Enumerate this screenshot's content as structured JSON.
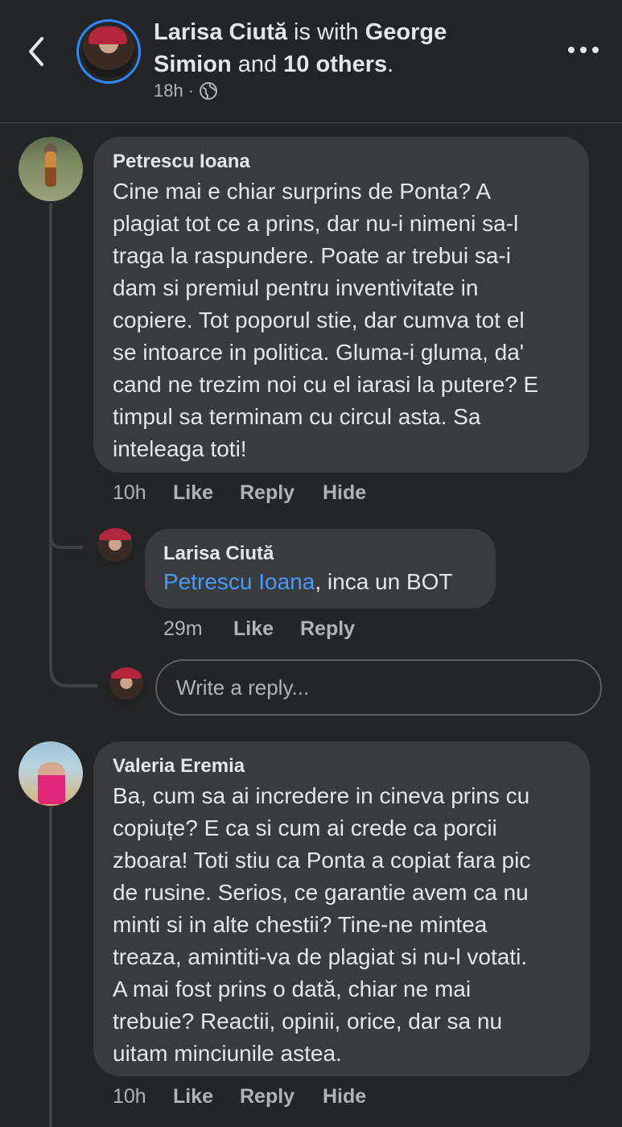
{
  "header": {
    "author": "Larisa Ciută",
    "with_text": " is with ",
    "tagged": "George Simion",
    "and_text": " and ",
    "others": "10 others",
    "period": ".",
    "time": "18h",
    "dot": "·",
    "privacy_icon": "globe-icon",
    "back_icon": "chevron-left-icon",
    "more_icon": "more-horizontal-icon"
  },
  "comments": [
    {
      "author": "Petrescu Ioana",
      "lines": [
        "Cine mai e chiar surprins de Ponta? A",
        "plagiat tot ce a prins, dar nu-i nimeni sa-l",
        "traga la raspundere. Poate ar trebui sa-i",
        "dam si premiul pentru inventivitate in",
        "copiere. Tot poporul stie, dar cumva tot el",
        "se intoarce in politica. Gluma-i gluma, da'",
        "cand ne trezim noi cu el iarasi la putere? E",
        "timpul sa terminam cu circul asta. Sa",
        "inteleaga toti!"
      ],
      "time": "10h",
      "like": "Like",
      "reply": "Reply",
      "hide": "Hide"
    },
    {
      "author": "Valeria Eremia",
      "lines": [
        "Ba, cum sa ai incredere in cineva prins cu",
        "copiuțe? E ca si cum ai crede ca porcii",
        "zboara! Toti stiu ca Ponta a copiat fara pic",
        "de rusine. Serios, ce garantie avem ca nu",
        "minti si in alte chestii? Tine-ne mintea",
        "treaza, amintiti-va de plagiat si nu-l votati.",
        "A mai fost prins o dată, chiar ne mai",
        "trebuie? Reactii, opinii, orice, dar sa nu",
        "uitam minciunile astea."
      ],
      "time": "10h",
      "like": "Like",
      "reply": "Reply",
      "hide": "Hide"
    }
  ],
  "reply": {
    "author": "Larisa Ciută",
    "mention": "Petrescu Ioana",
    "text": ", inca  un BOT",
    "time": "29m",
    "like": "Like",
    "reply": "Reply"
  },
  "reply_input": {
    "placeholder": "Write a reply..."
  }
}
